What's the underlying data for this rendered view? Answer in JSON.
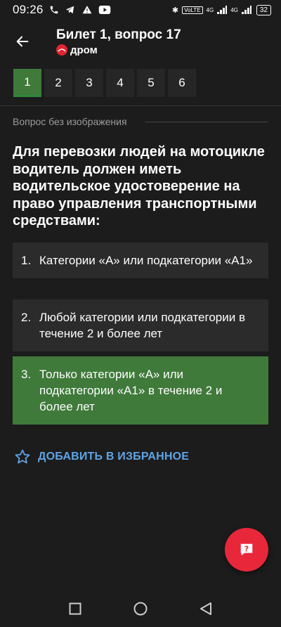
{
  "status_bar": {
    "time": "09:26",
    "network_label": "VoLTE",
    "signal1": "4G",
    "signal2": "4G",
    "battery": "32"
  },
  "header": {
    "title": "Билет 1, вопрос 17",
    "brand": "дром"
  },
  "tabs": [
    {
      "label": "1",
      "active": true
    },
    {
      "label": "2"
    },
    {
      "label": "3"
    },
    {
      "label": "4"
    },
    {
      "label": "5"
    },
    {
      "label": "6"
    }
  ],
  "no_image_label": "Вопрос без изображения",
  "question": "Для перевозки людей на мотоцикле водитель должен иметь водительское удостоверение на право управления транспортными средствами:",
  "answers": [
    {
      "num": "1.",
      "text": "Категории «А» или подкатегории «А1»"
    },
    {
      "num": "2.",
      "text": "Любой категории или подкатегории в течение 2 и более лет"
    },
    {
      "num": "3.",
      "text": "Только категории «А» или подкатегории «А1» в течение 2 и более лет",
      "correct": true
    }
  ],
  "favorite_label": "ДОБАВИТЬ В ИЗБРАННОЕ",
  "colors": {
    "background": "#1c1c1c",
    "correct": "#3f7a3b",
    "accent_link": "#5ea4e6",
    "fab": "#e8283a"
  }
}
